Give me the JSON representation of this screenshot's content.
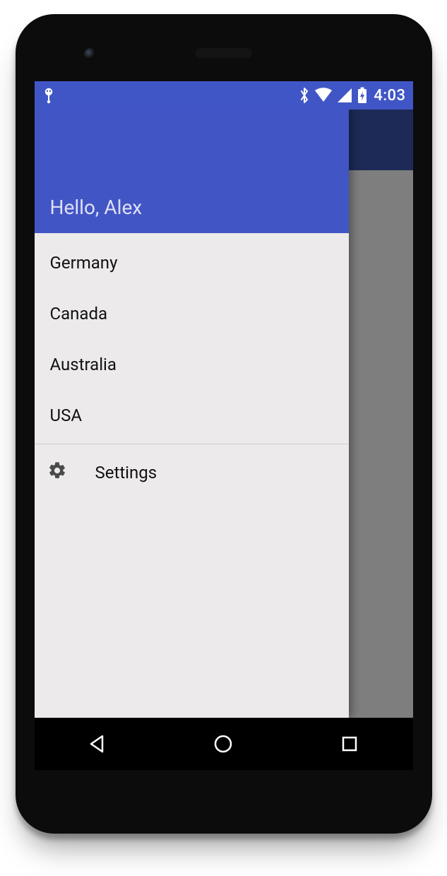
{
  "status": {
    "time": "4:03"
  },
  "drawer": {
    "greeting": "Hello, Alex",
    "items": [
      {
        "label": "Germany"
      },
      {
        "label": "Canada"
      },
      {
        "label": "Australia"
      },
      {
        "label": "USA"
      }
    ],
    "settings_label": "Settings"
  }
}
